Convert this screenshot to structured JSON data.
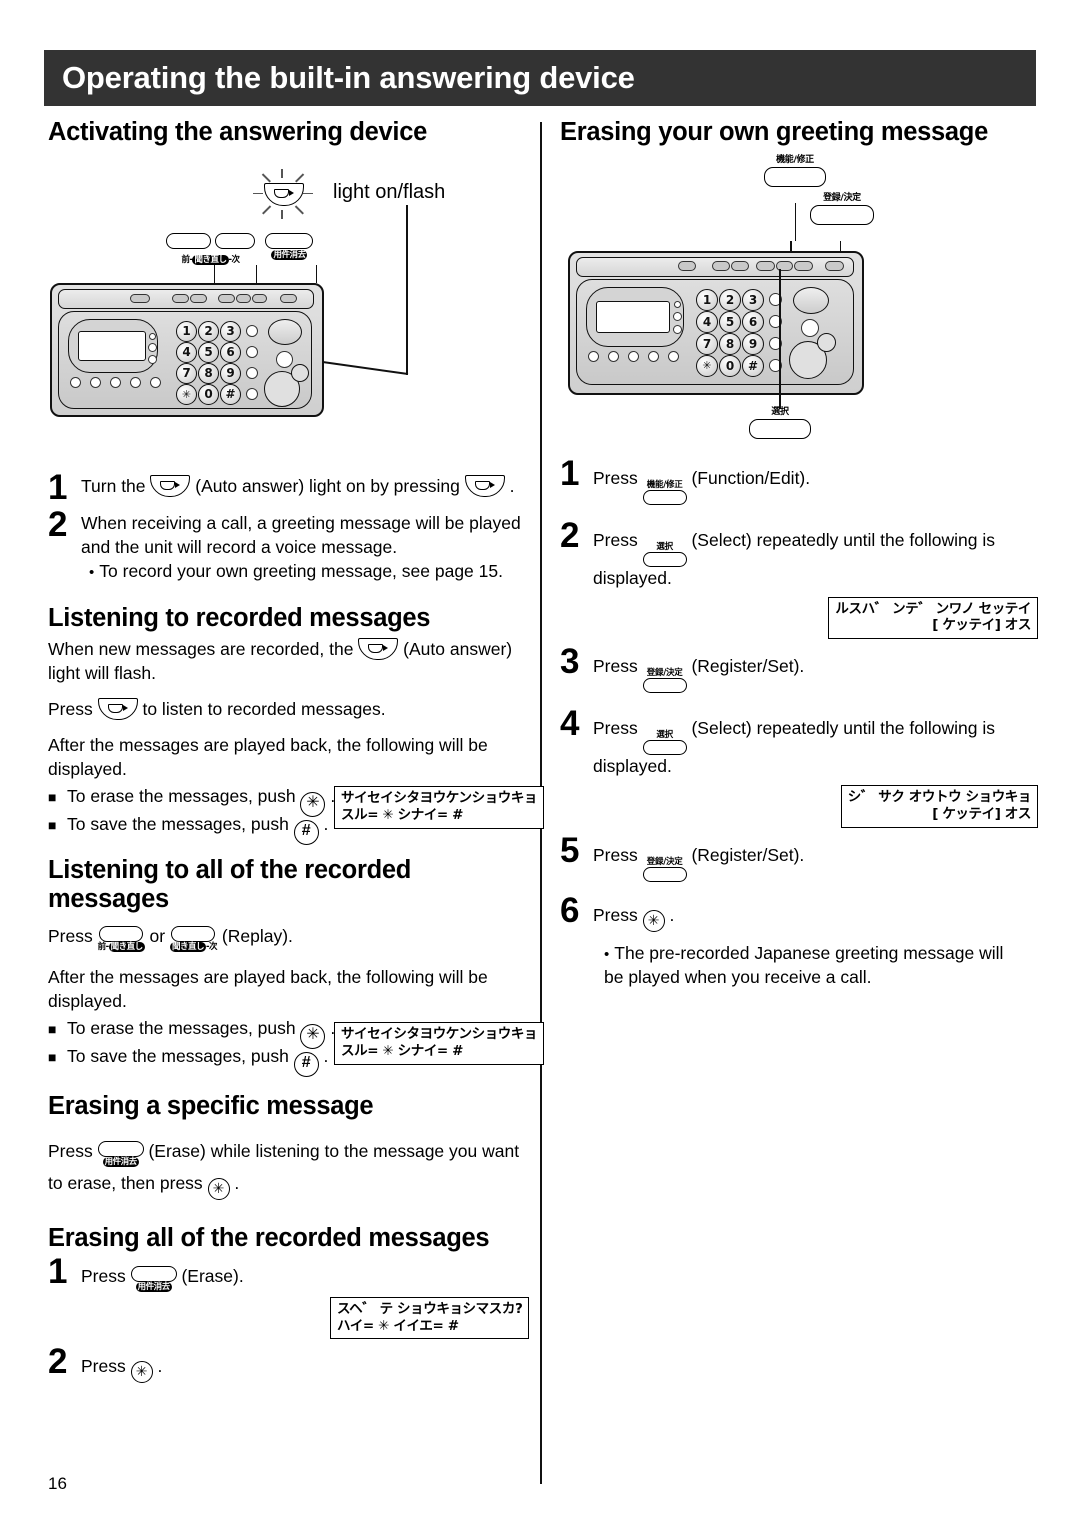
{
  "header": {
    "title": "Operating the built-in answering device"
  },
  "page_number": "16",
  "left": {
    "s1": {
      "heading": "Activating the answering device",
      "illus": {
        "light_label": "light on/flash",
        "keys": [
          {
            "jp_prefix": "前-",
            "jp_inv": "聞き直し",
            "jp_suffix": "-次"
          },
          {
            "jp_inv": "用件消去"
          }
        ],
        "keypad": [
          "1",
          "2",
          "3",
          "4",
          "5",
          "6",
          "7",
          "8",
          "9",
          "✳",
          "0",
          "#"
        ]
      },
      "steps": [
        {
          "num": "1",
          "pre": "Turn the ",
          "mid": " (Auto answer) light on by pressing ",
          "post": " ."
        },
        {
          "num": "2",
          "text": "When receiving a call, a greeting message will be played and the unit will record a voice message.",
          "bullet": "To record your own greeting message, see page 15."
        }
      ]
    },
    "s2": {
      "heading": "Listening to recorded messages",
      "p1a": "When new messages are recorded, the ",
      "p1b": " (Auto answer) light will flash.",
      "p2a": "Press ",
      "p2b": " to listen to recorded messages.",
      "p3": "After the messages are played back, the following will be displayed.",
      "erase": "To erase the messages, push ",
      "save": "To save the messages, push ",
      "lcd_line1": "サイセイシタヨウケンショウキョ",
      "lcd_line2": "スル= ✳ シナイ= #"
    },
    "s3": {
      "heading": "Listening to all of the recorded messages",
      "press": "Press ",
      "or": "or",
      "replay": "(Replay).",
      "key_a": {
        "jp_prefix": "前-",
        "jp_inv": "聞き直し"
      },
      "key_b": {
        "jp_inv": "聞き直し",
        "jp_suffix": "-次"
      },
      "p3": "After the messages are played back, the following will be displayed.",
      "erase": "To erase the messages, push ",
      "save": "To save the messages, push ",
      "lcd_line1": "サイセイシタヨウケンショウキョ",
      "lcd_line2": "スル= ✳ シナイ= #"
    },
    "s4": {
      "heading": "Erasing a specific message",
      "press": "Press ",
      "key_jp": "用件消去",
      "text_a": " (Erase) while listening to the message you want to erase, then press ",
      "text_b": " ."
    },
    "s5": {
      "heading": "Erasing all of the recorded messages",
      "step1_num": "1",
      "step1_press": "Press ",
      "step1_key_jp": "用件消去",
      "step1_after": " (Erase).",
      "step2_num": "2",
      "step2_press": "Press ",
      "step2_after": " .",
      "lcd_line1": "スヘ゛ テ ショウキョシマスカ?",
      "lcd_line2": "ハイ= ✳ イイエ= #"
    }
  },
  "right": {
    "heading": "Erasing your own greeting message",
    "illus": {
      "key_function": "機能/修正",
      "key_register": "登録/決定",
      "key_select": "選択",
      "keypad": [
        "1",
        "2",
        "3",
        "4",
        "5",
        "6",
        "7",
        "8",
        "9",
        "✳",
        "0",
        "#"
      ]
    },
    "steps": [
      {
        "num": "1",
        "press": "Press ",
        "key_jp": "機能/修正",
        "after": " (Function/Edit)."
      },
      {
        "num": "2",
        "press": "Press ",
        "key_jp": "選択",
        "after": " (Select) repeatedly until the following is displayed.",
        "lcd_line1": "ルスハ゛ ンテ゛ ンワノ  セッテイ",
        "lcd_line2": "[ ケッテイ] オス"
      },
      {
        "num": "3",
        "press": "Press ",
        "key_jp": "登録/決定",
        "after": " (Register/Set)."
      },
      {
        "num": "4",
        "press": "Press ",
        "key_jp": "選択",
        "after": " (Select) repeatedly until the following is displayed.",
        "lcd_line1": "シ゛ サク オウトウ ショウキョ",
        "lcd_line2": "[ ケッテイ] オス"
      },
      {
        "num": "5",
        "press": "Press ",
        "key_jp": "登録/決定",
        "after": " (Register/Set)."
      },
      {
        "num": "6",
        "press": "Press ",
        "after": " .",
        "bullet": "The pre-recorded Japanese greeting message will be played when you receive a call."
      }
    ]
  }
}
